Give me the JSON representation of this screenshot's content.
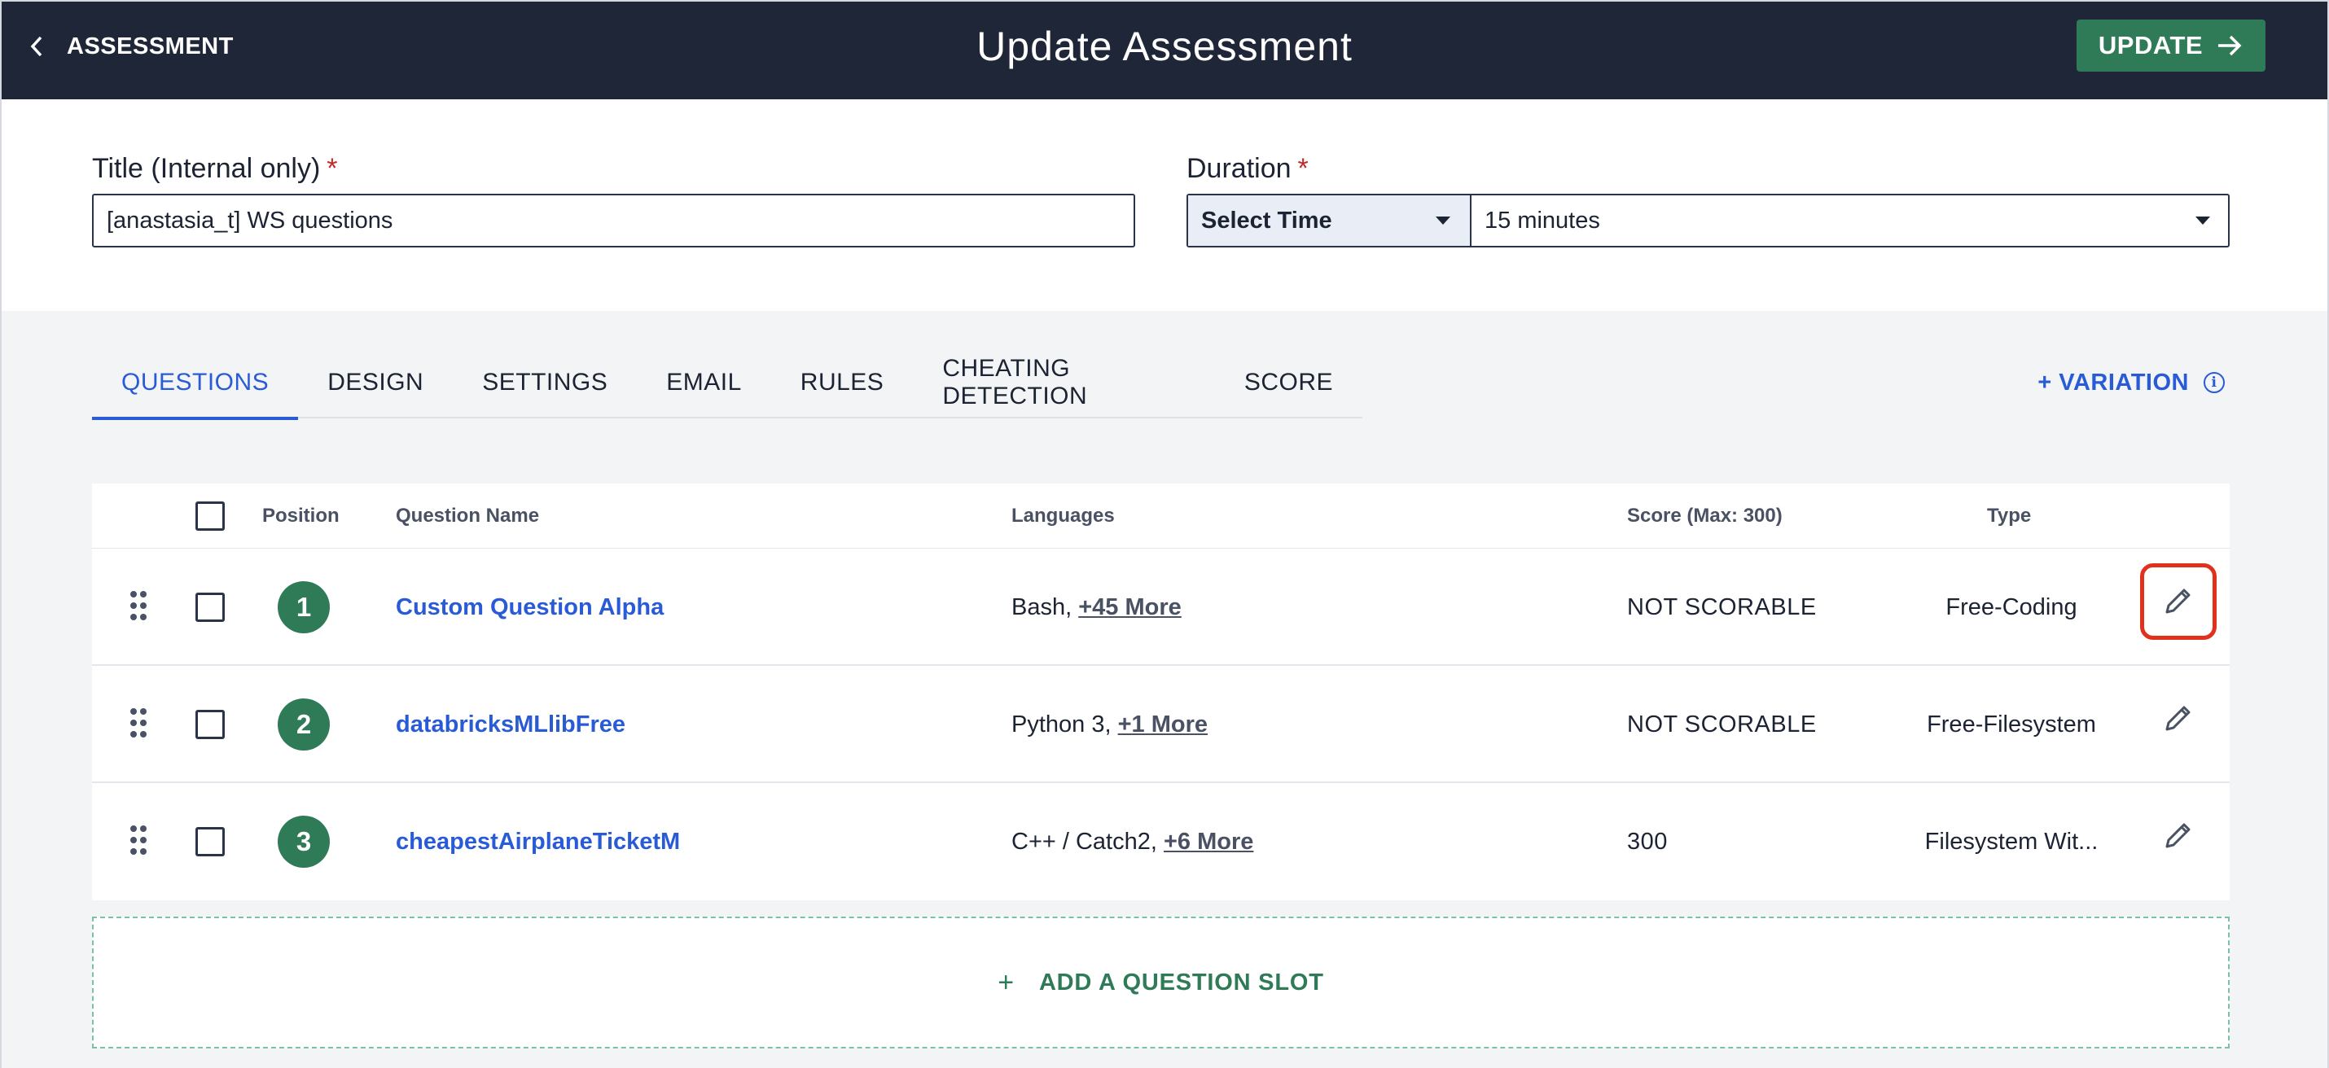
{
  "header": {
    "back_label": "ASSESSMENT",
    "title": "Update Assessment",
    "update_label": "UPDATE"
  },
  "form": {
    "title_label": "Title (Internal only)",
    "title_value": "[anastasia_t] WS questions",
    "duration_label": "Duration",
    "duration_unit": "Select Time",
    "duration_value": "15 minutes",
    "required_mark": "*"
  },
  "tabs": [
    {
      "label": "QUESTIONS",
      "active": true
    },
    {
      "label": "DESIGN"
    },
    {
      "label": "SETTINGS"
    },
    {
      "label": "EMAIL"
    },
    {
      "label": "RULES"
    },
    {
      "label": "CHEATING DETECTION"
    },
    {
      "label": "SCORE"
    }
  ],
  "variation_label": "+ VARIATION",
  "table": {
    "headers": {
      "position": "Position",
      "name": "Question Name",
      "languages": "Languages",
      "score": "Score (Max: 300)",
      "type": "Type"
    },
    "rows": [
      {
        "position": "1",
        "name": "Custom Question Alpha",
        "languages": "Bash,",
        "more": "+45 More",
        "score": "NOT SCORABLE",
        "type": "Free-Coding"
      },
      {
        "position": "2",
        "name": "databricksMLlibFree",
        "languages": "Python 3,",
        "more": "+1 More",
        "score": "NOT SCORABLE",
        "type": "Free-Filesystem"
      },
      {
        "position": "3",
        "name": "cheapestAirplaneTicketM",
        "languages": "C++ / Catch2,",
        "more": "+6 More",
        "score": "300",
        "type": "Filesystem Wit..."
      }
    ]
  },
  "add_slot": {
    "plus": "+",
    "label": "ADD A QUESTION SLOT"
  },
  "colors": {
    "header_bg": "#1e2638",
    "accent_green": "#2f7a57",
    "link_blue": "#2a5bd7",
    "highlight_red": "#e0311d"
  }
}
